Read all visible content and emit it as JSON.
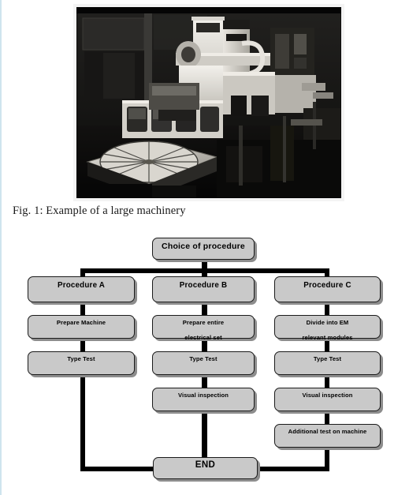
{
  "figure": {
    "caption": "Fig. 1: Example of a large machinery",
    "image_alt": "large-machinery-photo"
  },
  "flowchart": {
    "start": {
      "label": "Choice of procedure"
    },
    "end": {
      "label": "END"
    },
    "columns": [
      {
        "id": "A",
        "header": "Procedure A",
        "steps": [
          {
            "line1": "Prepare Machine",
            "line2": ""
          },
          {
            "line1": "Type Test",
            "line2": ""
          }
        ]
      },
      {
        "id": "B",
        "header": "Procedure B",
        "steps": [
          {
            "line1": "Prepare entire",
            "line2": "electrical set"
          },
          {
            "line1": "Type Test",
            "line2": ""
          },
          {
            "line1": "Visual inspection",
            "line2": ""
          }
        ]
      },
      {
        "id": "C",
        "header": "Procedure C",
        "steps": [
          {
            "line1": "Divide into EM",
            "line2": "relevant modules"
          },
          {
            "line1": "Type Test",
            "line2": ""
          },
          {
            "line1": "Visual inspection",
            "line2": ""
          },
          {
            "line1": "Additional test on machine",
            "line2": ""
          }
        ]
      }
    ]
  },
  "colors": {
    "node_fill": "#c9c9c9",
    "node_border": "#1b1b1b",
    "connector": "#000000",
    "page_background": "#ffffff",
    "edge_rule": "#cfe4ee"
  }
}
